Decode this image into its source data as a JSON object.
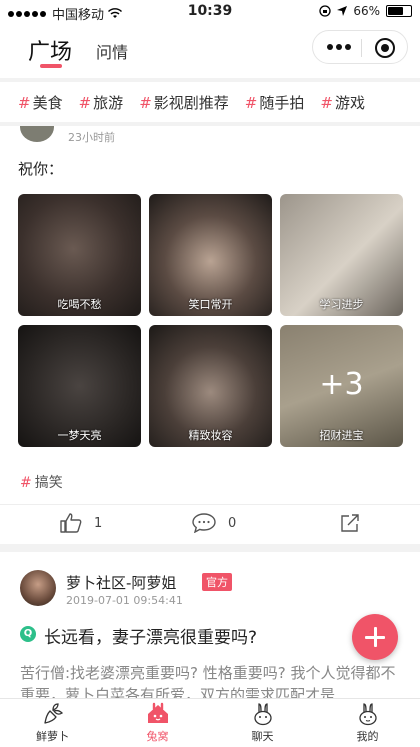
{
  "status_bar": {
    "carrier": "中国移动",
    "time": "10:39",
    "battery": "66%",
    "battery_level": 0.66
  },
  "top_nav": {
    "tabs": [
      {
        "label": "广场",
        "active": true
      },
      {
        "label": "问情",
        "active": false
      }
    ]
  },
  "categories": [
    "美食",
    "旅游",
    "影视剧推荐",
    "随手拍",
    "游戏"
  ],
  "feed": {
    "post1": {
      "time": "23小时前",
      "text": "祝你：",
      "images": [
        {
          "caption": "吃喝不愁"
        },
        {
          "caption": "笑口常开"
        },
        {
          "caption": "学习进步"
        },
        {
          "caption": "一梦天亮"
        },
        {
          "caption": "精致妆容"
        },
        {
          "caption": "招财进宝"
        }
      ],
      "more_count": "+3",
      "tag": "搞笑",
      "likes": "1",
      "comments": "0"
    },
    "post2": {
      "author": "萝卜社区-阿萝姐",
      "badge": "官方",
      "time": "2019-07-01 09:54:41",
      "question_mark": "Q",
      "question": "长远看，妻子漂亮很重要吗?",
      "preview": "苦行僧:找老婆漂亮重要吗? 性格重要吗? 我个人觉得都不重要，萝卜白菜各有所爱，双方的需求匹配才是"
    }
  },
  "tab_bar": {
    "items": [
      {
        "label": "鲜萝卜",
        "icon": "radish-icon",
        "active": false
      },
      {
        "label": "兔窝",
        "icon": "rabbit-house-icon",
        "active": true
      },
      {
        "label": "聊天",
        "icon": "rabbit-chat-icon",
        "active": false
      },
      {
        "label": "我的",
        "icon": "rabbit-profile-icon",
        "active": false
      }
    ]
  },
  "colors": {
    "accent": "#f05468",
    "question_badge": "#2dbf8a"
  }
}
